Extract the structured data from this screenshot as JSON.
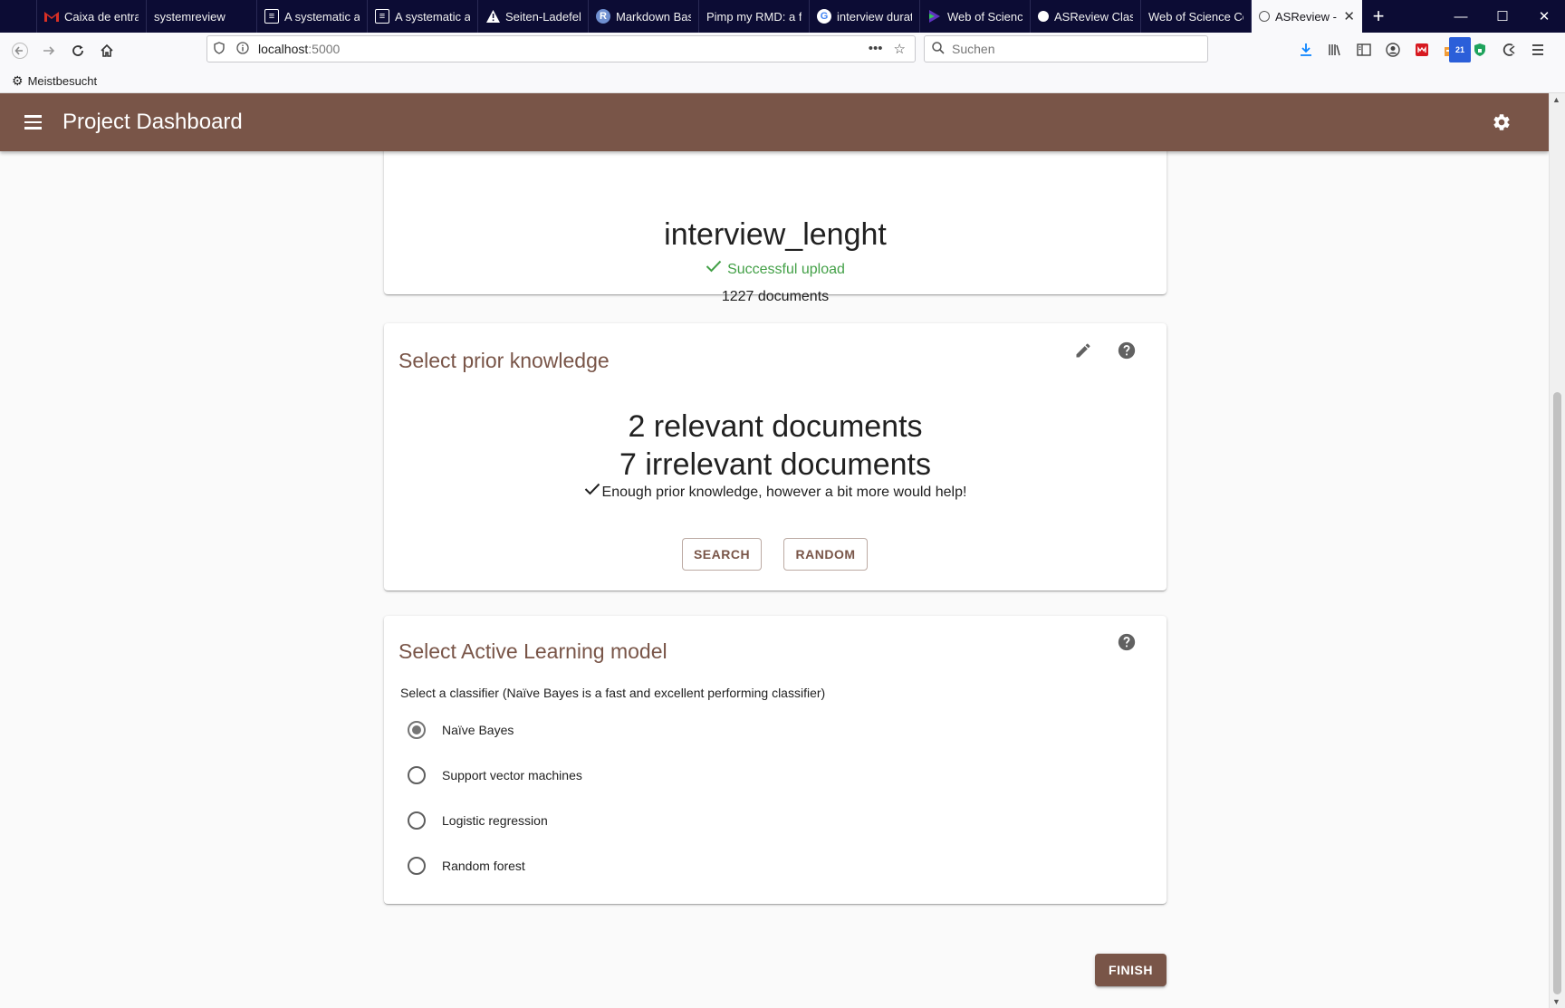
{
  "browser": {
    "tabs": [
      {
        "title": "Caixa de entrad",
        "icon": "gmail-icon",
        "icon_color": "#d93025"
      },
      {
        "title": "systemreview",
        "icon": "",
        "icon_color": ""
      },
      {
        "title": "A systematic ap",
        "icon": "document-icon",
        "icon_color": "#ffffff"
      },
      {
        "title": "A systematic ap",
        "icon": "document-icon",
        "icon_color": "#ffffff"
      },
      {
        "title": "Seiten-Ladefeh",
        "icon": "warning-icon",
        "icon_color": "#ffffff"
      },
      {
        "title": "Markdown Bas",
        "icon": "r-icon",
        "icon_color": "#6f8fd0"
      },
      {
        "title": "Pimp my RMD: a fe",
        "icon": "",
        "icon_color": ""
      },
      {
        "title": "interview durat",
        "icon": "google-icon",
        "icon_color": "#4285f4"
      },
      {
        "title": "Web of Science",
        "icon": "clarivate-icon",
        "icon_color": "#5e33bf"
      },
      {
        "title": "ASReview Class",
        "icon": "asreview-icon",
        "icon_color": "#ffffff"
      },
      {
        "title": "Web of Science Co",
        "icon": "",
        "icon_color": ""
      }
    ],
    "active_tab": {
      "title": "ASReview -",
      "icon": "asreview-icon"
    },
    "url_host": "localhost",
    "url_port": ":5000",
    "search_placeholder": "Suchen",
    "bookmark": "Meistbesucht",
    "addon_badge": "21"
  },
  "appbar": {
    "title": "Project Dashboard",
    "background": "#795548"
  },
  "project": {
    "name": "interview_lenght",
    "upload_status": "Successful upload",
    "document_count": "1227 documents"
  },
  "prior_knowledge": {
    "title": "Select prior knowledge",
    "relevant": "2 relevant documents",
    "irrelevant": "7 irrelevant documents",
    "note": "Enough prior knowledge, however a bit more would help!",
    "search_label": "SEARCH",
    "random_label": "RANDOM"
  },
  "model": {
    "title": "Select Active Learning model",
    "hint": "Select a classifier (Naïve Bayes is a fast and excellent performing classifier)",
    "options": [
      {
        "label": "Naïve Bayes",
        "selected": true
      },
      {
        "label": "Support vector machines",
        "selected": false
      },
      {
        "label": "Logistic regression",
        "selected": false
      },
      {
        "label": "Random forest",
        "selected": false
      }
    ]
  },
  "finish_label": "FINISH",
  "colors": {
    "accent": "#795548",
    "success": "#43a047"
  }
}
